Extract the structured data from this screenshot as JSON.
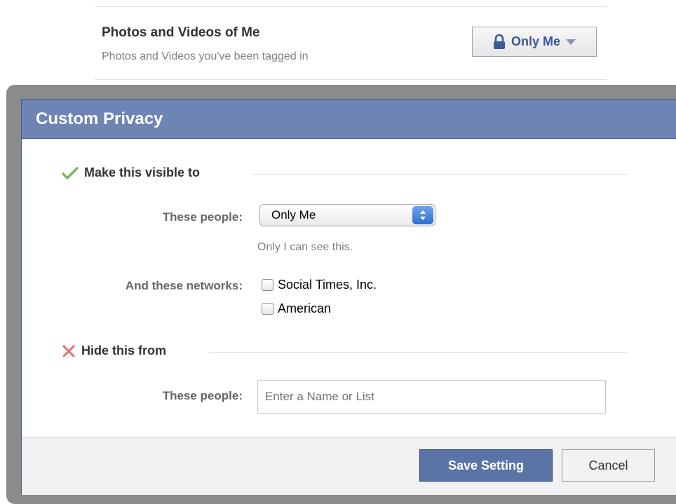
{
  "background_setting": {
    "title": "Photos and Videos of Me",
    "subtitle": "Photos and Videos you've been tagged in",
    "privacy_button_label": "Only Me"
  },
  "dialog": {
    "title": "Custom Privacy",
    "visible_section": {
      "heading": "Make this visible to",
      "people_label": "These people:",
      "people_selected": "Only Me",
      "people_hint": "Only I can see this.",
      "networks_label": "And these networks:",
      "networks": [
        {
          "label": "Social Times, Inc.",
          "checked": false
        },
        {
          "label": "American",
          "checked": false
        }
      ]
    },
    "hide_section": {
      "heading": "Hide this from",
      "people_label": "These people:",
      "people_placeholder": "Enter a Name or List"
    },
    "buttons": {
      "save_label": "Save Setting",
      "cancel_label": "Cancel"
    }
  },
  "icons": {
    "privacy_button": "lock-icon",
    "visible_heading": "checkmark-icon",
    "hide_heading": "x-icon"
  },
  "colors": {
    "header_bg": "#6d84b4",
    "primary_button": "#5b74a8",
    "link_blue": "#3b5998",
    "check_green": "#7ab55c",
    "x_red": "#e07a7a"
  }
}
